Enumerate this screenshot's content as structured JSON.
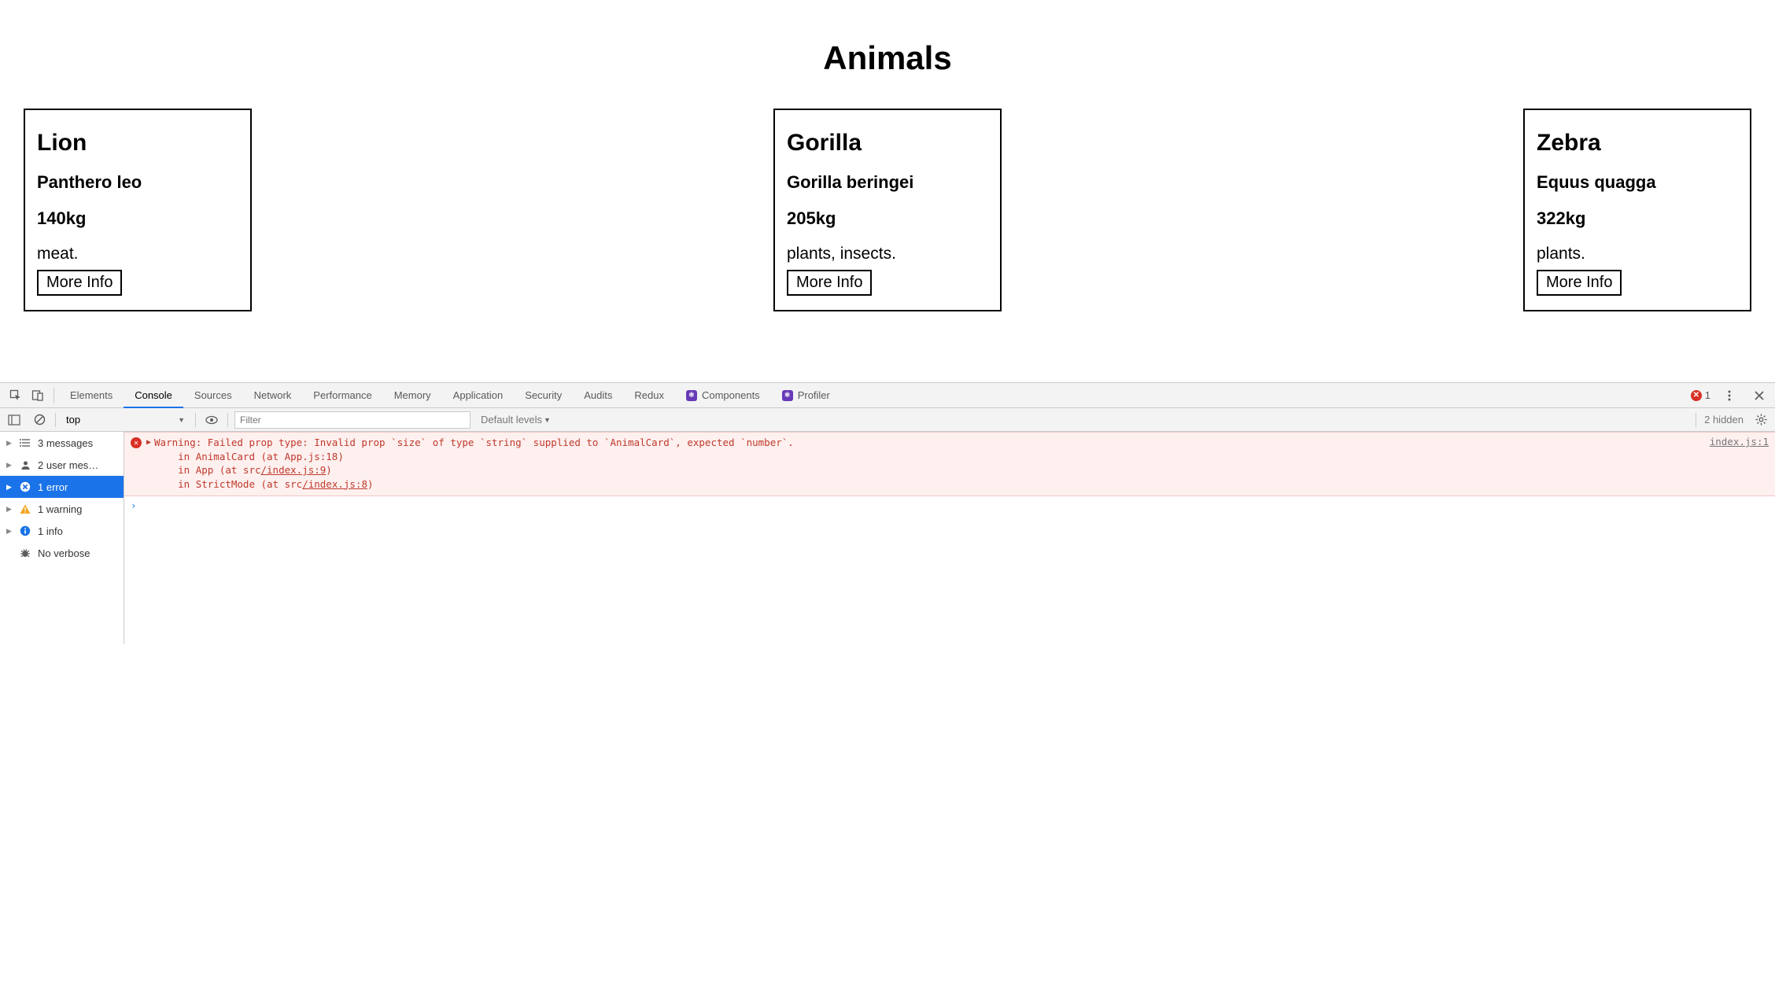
{
  "page": {
    "title": "Animals",
    "more_info_label": "More Info"
  },
  "animals": [
    {
      "name": "Lion",
      "species": "Panthero leo",
      "size": "140kg",
      "diet": "meat."
    },
    {
      "name": "Gorilla",
      "species": "Gorilla beringei",
      "size": "205kg",
      "diet": "plants, insects."
    },
    {
      "name": "Zebra",
      "species": "Equus quagga",
      "size": "322kg",
      "diet": "plants."
    }
  ],
  "devtools": {
    "tabs": [
      "Elements",
      "Console",
      "Sources",
      "Network",
      "Performance",
      "Memory",
      "Application",
      "Security",
      "Audits",
      "Redux"
    ],
    "ext_tabs": [
      "Components",
      "Profiler"
    ],
    "active_tab": "Console",
    "error_count": "1",
    "toolbar": {
      "context": "top",
      "filter_placeholder": "Filter",
      "levels": "Default levels",
      "hidden": "2 hidden"
    },
    "sidebar": {
      "messages": "3 messages",
      "user": "2 user mes…",
      "errors": "1 error",
      "warnings": "1 warning",
      "info": "1 info",
      "verbose": "No verbose"
    },
    "console": {
      "warning_prefix": "Warning: Failed prop type: Invalid prop `size` of type `string` supplied to `AnimalCard`, expected `number`.",
      "stack1": "    in AnimalCard (at App.js:18)",
      "stack2_pre": "    in App (at src",
      "stack2_link": "/index.js:9",
      "stack2_post": ")",
      "stack3_pre": "    in StrictMode (at src",
      "stack3_link": "/index.js:8",
      "stack3_post": ")",
      "source": "index.js:1",
      "prompt": "›"
    }
  }
}
